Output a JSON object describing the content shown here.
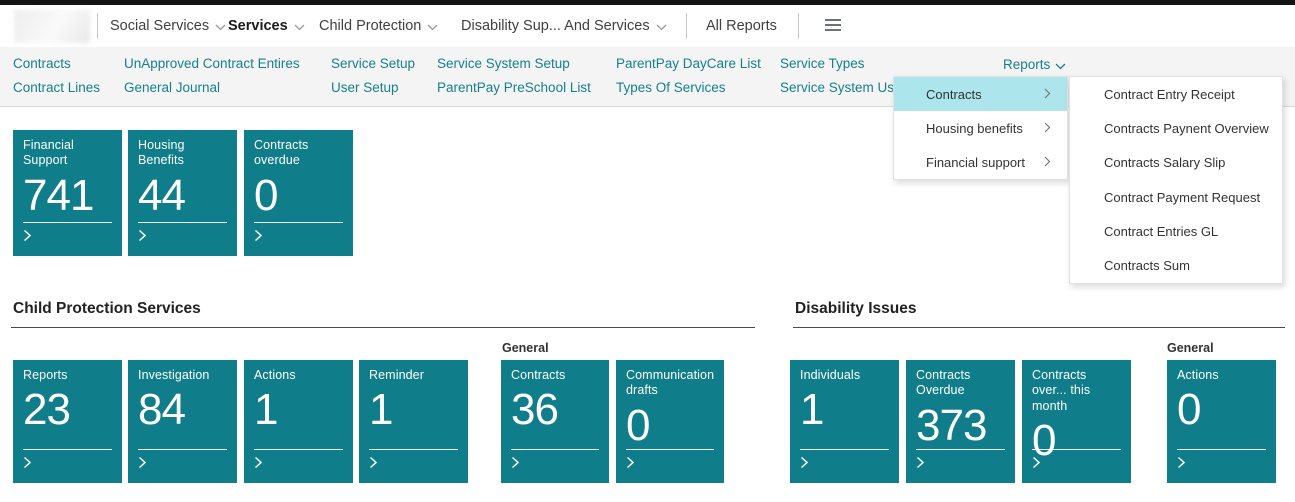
{
  "theme": {
    "accent": "#0f7e8a",
    "nav_link": "#16808d",
    "menu_highlight": "#ace5eb"
  },
  "topnav": {
    "menus": [
      "Social Services",
      "Services",
      "Child Protection",
      "Disability Sup... And Services"
    ],
    "all_reports": "All Reports",
    "hamburger_icon": "menu"
  },
  "subnav": {
    "row1": [
      "Contracts",
      "UnApproved Contract Entires",
      "Service Setup",
      "Service System Setup",
      "ParentPay DayCare List",
      "Service Types"
    ],
    "row2": [
      "Contract Lines",
      "General Journal",
      "User Setup",
      "ParentPay PreSchool List",
      "Types Of Services",
      "Service System Us"
    ],
    "reports_trigger": "Reports"
  },
  "reports_menu": {
    "groups": [
      {
        "label": "Contracts",
        "highlighted": true
      },
      {
        "label": "Housing benefits",
        "highlighted": false
      },
      {
        "label": "Financial support",
        "highlighted": false
      }
    ],
    "submenu": [
      "Contract Entry Receipt",
      "Contracts Paynent Overview",
      "Contracts Salary Slip",
      "Contract Payment Request",
      "Contract Entries GL",
      "Contracts Sum"
    ]
  },
  "home_tiles": [
    {
      "label": "Financial Support",
      "value": "741"
    },
    {
      "label": "Housing Benefits",
      "value": "44"
    },
    {
      "label": "Contracts overdue",
      "value": "0"
    }
  ],
  "child_protection": {
    "title": "Child Protection Services",
    "general_label": "General",
    "tiles": [
      {
        "label": "Reports",
        "value": "23"
      },
      {
        "label": "Investigation",
        "value": "84"
      },
      {
        "label": "Actions",
        "value": "1"
      },
      {
        "label": "Reminder",
        "value": "1"
      }
    ],
    "general_tiles": [
      {
        "label": "Contracts",
        "value": "36"
      },
      {
        "label": "Communication drafts",
        "value": "0"
      }
    ]
  },
  "disability": {
    "title": "Disability Issues",
    "general_label": "General",
    "tiles": [
      {
        "label": "Individuals",
        "value": "1"
      },
      {
        "label": "Contracts Overdue",
        "value": "373"
      },
      {
        "label": "Contracts over... this month",
        "value": "0"
      }
    ],
    "general_tiles": [
      {
        "label": "Actions",
        "value": "0"
      }
    ]
  }
}
